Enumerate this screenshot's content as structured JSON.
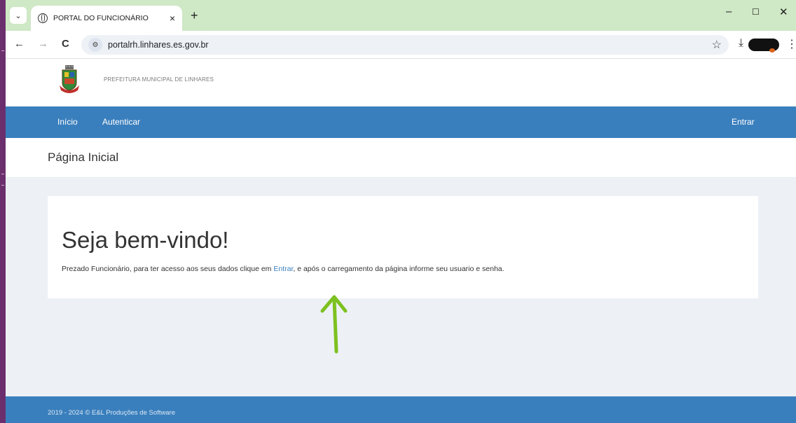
{
  "browser": {
    "tab_title": "PORTAL DO FUNCIONÁRIO",
    "tab_close": "×",
    "new_tab": "+",
    "window_controls": {
      "minimize": "–",
      "maximize": "☐",
      "close": "✕"
    },
    "nav": {
      "back": "←",
      "forward": "→",
      "reload": "C"
    },
    "url": "portalrh.linhares.es.gov.br",
    "bookmark_icon": "star-icon",
    "download_icon": "download-icon",
    "menu_icon": "kebab-menu-icon"
  },
  "site": {
    "org_name": "PREFEITURA MUNICIPAL DE LINHARES",
    "logo_icon": "municipal-crest-icon"
  },
  "navbar": {
    "items": [
      {
        "label": "Início"
      },
      {
        "label": "Autenticar"
      }
    ],
    "right_label": "Entrar"
  },
  "page": {
    "title": "Página Inicial"
  },
  "card": {
    "heading": "Seja bem-vindo!",
    "text_before": "Prezado Funcionário, para ter acesso aos seus dados clique em ",
    "link_label": "Entrar",
    "text_after": ", e após o carregamento da página informe seu usuario e senha."
  },
  "annotation": {
    "arrow_color": "#7dc11f",
    "arrow_icon": "up-arrow-annotation"
  },
  "footer": {
    "text": "2019 - 2024 © E&L Produções de Software"
  },
  "colors": {
    "brand_blue": "#3a7fbd",
    "tabstrip_green": "#cfe8c5"
  }
}
